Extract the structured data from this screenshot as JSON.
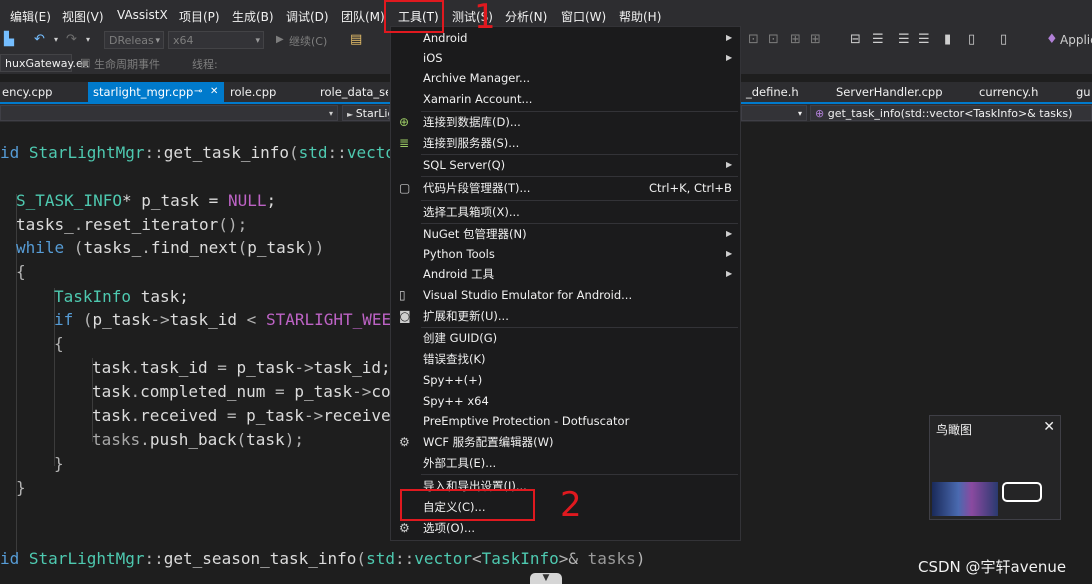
{
  "menubar": {
    "items": [
      "编辑(E)",
      "视图(V)",
      "VAssistX",
      "项目(P)",
      "生成(B)",
      "调试(D)",
      "团队(M)",
      "工具(T)",
      "测试(S)",
      "分析(N)",
      "窗口(W)",
      "帮助(H)"
    ]
  },
  "toolbar": {
    "config_value": "DReleas",
    "platform_value": "x64",
    "continue_label": "继续(C)",
    "right_label": "Applic"
  },
  "toolbar2": {
    "project_combo": "huxGateway.ex",
    "lifecycle_label": "生命周期事件",
    "thread_label": "线程:"
  },
  "tabs": [
    "ency.cpp",
    "starlight_mgr.cpp",
    "role.cpp",
    "role_data_serv",
    "_define.h",
    "ServerHandler.cpp",
    "currency.h",
    "gu"
  ],
  "navbar": {
    "scope": "StarLig",
    "member": "get_task_info(std::vector<TaskInfo>& tasks)"
  },
  "code": {
    "l1": [
      "id ",
      "StarLightMgr",
      "::",
      "get_task_info",
      "(",
      "std",
      "::",
      "vecto"
    ],
    "l2": [
      "S_TASK_INFO",
      "* ",
      "p_task",
      " = ",
      "NULL",
      ";"
    ],
    "l3": [
      "tasks_",
      ".",
      "reset_iterator",
      "();"
    ],
    "l4": [
      "while",
      " (",
      "tasks_",
      ".",
      "find_next",
      "(",
      "p_task",
      "))"
    ],
    "l5": "{",
    "l6": [
      "TaskInfo",
      " task;"
    ],
    "l7": [
      "if",
      " (",
      "p_task",
      "->",
      "task_id",
      " < ",
      "STARLIGHT_WEE"
    ],
    "l8": "{",
    "l9": [
      "task",
      ".",
      "task_id",
      " = ",
      "p_task",
      "->",
      "task_id",
      ";"
    ],
    "l10": [
      "task",
      ".",
      "completed_num",
      " = ",
      "p_task",
      "->",
      "co"
    ],
    "l11": [
      "task",
      ".",
      "received",
      " = ",
      "p_task",
      "->",
      "receive"
    ],
    "l12": [
      "tasks",
      ".",
      "push_back",
      "(",
      "task",
      ");"
    ],
    "l13": "}",
    "l14": "}",
    "l15": [
      "id ",
      "StarLightMgr",
      "::",
      "get_season_task_info",
      "(",
      "std",
      "::",
      "vector",
      "<",
      "TaskInfo",
      ">& ",
      "tasks",
      ")"
    ]
  },
  "tools_menu": {
    "items": [
      {
        "label": "Android",
        "submenu": true
      },
      {
        "label": "iOS",
        "submenu": true
      },
      {
        "label": "Archive Manager..."
      },
      {
        "label": "Xamarin Account..."
      },
      {
        "label": "连接到数据库(D)..."
      },
      {
        "label": "连接到服务器(S)..."
      },
      {
        "label": "SQL Server(Q)",
        "submenu": true
      },
      {
        "label": "代码片段管理器(T)...",
        "shortcut": "Ctrl+K, Ctrl+B"
      },
      {
        "label": "选择工具箱项(X)..."
      },
      {
        "label": "NuGet 包管理器(N)",
        "submenu": true
      },
      {
        "label": "Python Tools",
        "submenu": true
      },
      {
        "label": "Android 工具",
        "submenu": true
      },
      {
        "label": "Visual Studio Emulator for Android..."
      },
      {
        "label": "扩展和更新(U)..."
      },
      {
        "label": "创建 GUID(G)"
      },
      {
        "label": "错误查找(K)"
      },
      {
        "label": "Spy++(+)"
      },
      {
        "label": "Spy++ x64"
      },
      {
        "label": "PreEmptive Protection - Dotfuscator"
      },
      {
        "label": "WCF 服务配置编辑器(W)"
      },
      {
        "label": "外部工具(E)..."
      },
      {
        "label": "导入和导出设置(I)..."
      },
      {
        "label": "自定义(C)..."
      },
      {
        "label": "选项(O)..."
      }
    ]
  },
  "annotations": {
    "number_1": "1",
    "number_2": "2"
  },
  "birdseye": {
    "title": "鸟瞰图",
    "close": "✕"
  },
  "watermark": "CSDN @宇轩avenue",
  "colors": {
    "accent": "#007acc",
    "annotation_red": "#e0191f",
    "background": "#1e1e1e"
  }
}
